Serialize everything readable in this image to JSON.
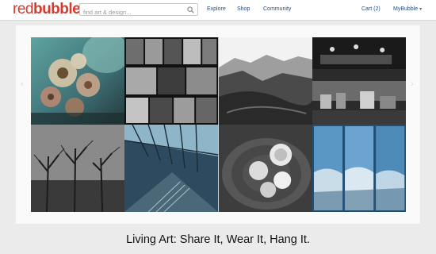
{
  "header": {
    "logo_text_a": "red",
    "logo_text_b": "bubble",
    "search": {
      "placeholder": "find art & design...",
      "value": ""
    },
    "nav": [
      "Explore",
      "Shop",
      "Community"
    ],
    "cart_label": "Cart (2)",
    "account_label": "MyBubble",
    "account_caret": "▾"
  },
  "gallery": {
    "tiles": [
      {
        "subject": "flower bouquet photo"
      },
      {
        "subject": "contact sheet strips photo"
      },
      {
        "subject": "mountain landscape photo"
      },
      {
        "subject": "diner interior photo"
      },
      {
        "subject": "bare trees photo"
      },
      {
        "subject": "glass roof station photo"
      },
      {
        "subject": "cut onion photo"
      },
      {
        "subject": "blue wave triptych photo"
      }
    ]
  },
  "caption": "Living Art: Share It, Wear It, Hang It.",
  "colors": {
    "brand": "#d63a2f",
    "link": "#2a4d7a",
    "background": "#ebebeb"
  }
}
